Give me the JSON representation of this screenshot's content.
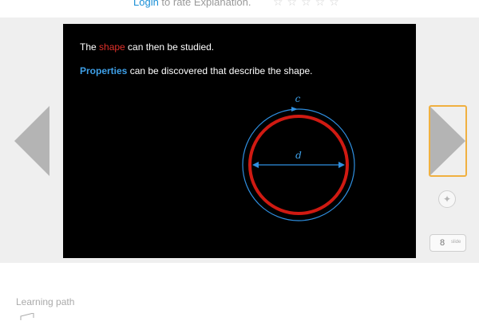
{
  "rating": {
    "login_link": "Login",
    "prompt": " to rate Explanation.",
    "stars": "☆☆☆☆☆"
  },
  "slide": {
    "line1": {
      "prefix": "The ",
      "highlight": "shape",
      "suffix": " can then be studied."
    },
    "line2": {
      "highlight": "Properties",
      "suffix": " can be discovered that describe the shape."
    },
    "diagram": {
      "circumference_label": "c",
      "diameter_label": "d"
    }
  },
  "controls": {
    "zoom_icon": "✦",
    "page_number": "8",
    "page_suffix": "slide"
  },
  "learning_path": {
    "label": "Learning path"
  },
  "colors": {
    "accent_link": "#1a8fd6",
    "highlight_red": "#e0302a",
    "highlight_blue": "#3ea0e8",
    "next_border": "#f0b040"
  }
}
